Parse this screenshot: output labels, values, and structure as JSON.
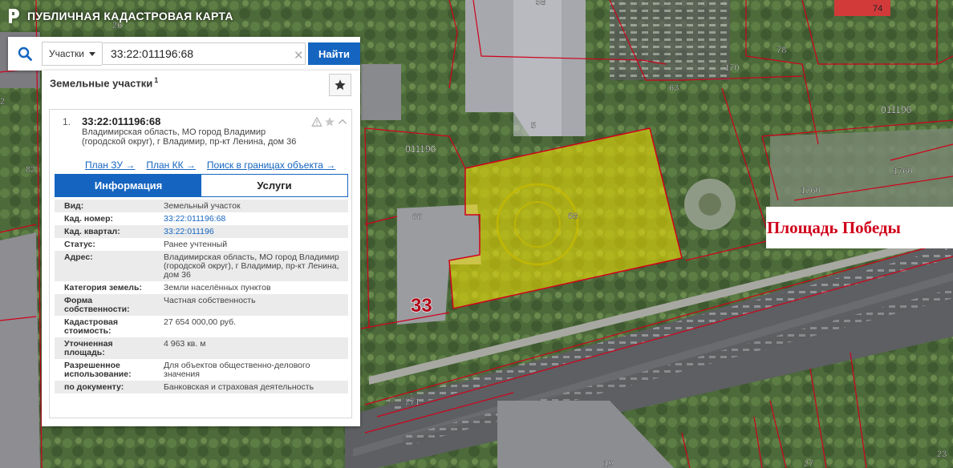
{
  "app": {
    "title": "ПУБЛИЧНАЯ КАДАСТРОВАЯ КАРТА",
    "logo_icon": "pkk-logo-icon"
  },
  "search": {
    "type_label": "Участки",
    "query": "33:22:011196:68",
    "find_label": "Найти"
  },
  "panel": {
    "title": "Земельные участки",
    "count": "1",
    "result": {
      "index": "1.",
      "cad_number": "33:22:011196:68",
      "address": "Владимирская область, МО город Владимир (городской округ), г Владимир, пр-кт Ленина, дом 36",
      "links": [
        "План ЗУ →",
        "План КК →",
        "Поиск в границах объекта →"
      ],
      "tabs": [
        "Информация",
        "Услуги"
      ],
      "info": [
        {
          "key": "Вид:",
          "value": "Земельный участок",
          "link": false
        },
        {
          "key": "Кад. номер:",
          "value": "33:22:011196:68",
          "link": true
        },
        {
          "key": "Кад. квартал:",
          "value": "33:22:011196",
          "link": true
        },
        {
          "key": "Статус:",
          "value": "Ранее учтенный",
          "link": false
        },
        {
          "key": "Адрес:",
          "value": "Владимирская область, МО город Владимир (городской округ), г Владимир, пр-кт Ленина, дом 36",
          "link": false
        },
        {
          "key": "Категория земель:",
          "value": "Земли населённых пунктов",
          "link": false
        },
        {
          "key": "Форма собственности:",
          "value": "Частная собственность",
          "link": false
        },
        {
          "key": "Кадастровая стоимость:",
          "value": "27 654 000,00 руб.",
          "link": false
        },
        {
          "key": "Уточненная площадь:",
          "value": "4 963 кв. м",
          "link": false
        },
        {
          "key": "Разрешенное использование:",
          "value": "Для объектов общественно-делового значения",
          "link": false
        },
        {
          "key": "по документу:",
          "value": "Банковская и страховая деятельность",
          "link": false
        }
      ]
    }
  },
  "map": {
    "parcel_labels": [
      "58",
      "26",
      "74",
      "78",
      "170",
      "63",
      "5",
      "011196",
      "011196",
      "82",
      "2",
      "1760",
      "1760",
      "66",
      "68",
      "33",
      "271",
      "19",
      "27",
      "23"
    ],
    "place_label": "Площадь Победы",
    "colors": {
      "parcel_highlight": "#f5e400",
      "boundary": "#d0021b",
      "accent": "#1565c0"
    }
  }
}
